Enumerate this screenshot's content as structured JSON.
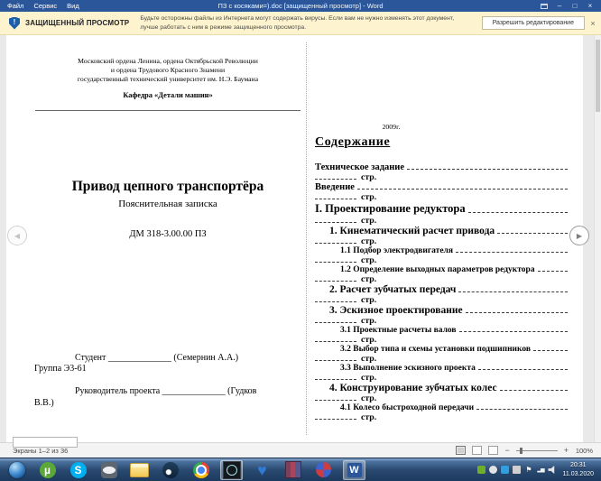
{
  "window": {
    "menu": [
      "Файл",
      "Сервис",
      "Вид"
    ],
    "title": "ПЗ с косяками=).doc [защищенный просмотр] - Word"
  },
  "banner": {
    "label": "ЗАЩИЩЕННЫЙ ПРОСМОТР",
    "message": "Будьте осторожны файлы из Интернета могут содержать вирусы. Если вам не нужно изменять этот документ, лучше работать с ним в режиме защищенного просмотра.",
    "button_label": "Разрешить редактирование"
  },
  "document": {
    "left_page": {
      "university_line1": "Московский ордена Ленина, ордена Октябрьской Революции",
      "university_line2": "и ордена Трудового Красного Знамени",
      "university_line3": "государственный технический университет им. Н.Э. Баумана",
      "department": "Кафедра «Детали машин»",
      "title": "Привод цепного транспортёра",
      "subtitle": "Пояснительная записка",
      "doc_code": "ДМ 318-3.00.00 ПЗ",
      "student_line": "Студент ______________ (Семернин А.А.)",
      "group_line": "Группа Э3-61",
      "supervisor_line1": "Руководитель проекта ______________ (Гудков",
      "supervisor_line2": "В.В.)"
    },
    "right_page": {
      "year": "2009г.",
      "heading": "Содержание",
      "page_word": "стр.",
      "entries": [
        {
          "label": "Техническое задание",
          "level": 0,
          "cls": "t-main"
        },
        {
          "label": "Введение",
          "level": 0,
          "cls": "t-main"
        },
        {
          "label": "I. Проектирование редуктора",
          "level": 0,
          "cls": "t-chapter"
        },
        {
          "label": "1. Кинематический расчет привода",
          "level": 1,
          "cls": "t-section"
        },
        {
          "label": "1.1 Подбор электродвигателя",
          "level": 2,
          "cls": "t-sub"
        },
        {
          "label": "1.2 Определение выходных параметров редуктора",
          "level": 2,
          "cls": "t-sub"
        },
        {
          "label": "2. Расчет зубчатых передач",
          "level": 1,
          "cls": "t-section"
        },
        {
          "label": "3. Эскизное проектирование",
          "level": 1,
          "cls": "t-section"
        },
        {
          "label": "3.1 Проектные расчеты валов",
          "level": 2,
          "cls": "t-sub"
        },
        {
          "label": "3.2 Выбор типа и схемы установки подшипников",
          "level": 2,
          "cls": "t-sub"
        },
        {
          "label": "3.3 Выполнение эскизного проекта",
          "level": 2,
          "cls": "t-sub"
        },
        {
          "label": "4. Конструирование зубчатых колес",
          "level": 1,
          "cls": "t-section"
        },
        {
          "label": "4.1 Колесо быстроходной передачи",
          "level": 2,
          "cls": "t-sub"
        }
      ]
    }
  },
  "status_bar": {
    "screens": "Экраны 1–2 из 36",
    "zoom_level": "100%"
  },
  "taskbar": {
    "icons": [
      "start-button",
      "utorrent-icon",
      "skype-icon",
      "discord-icon",
      "explorer-icon",
      "steam-icon",
      "chrome-icon",
      "osu-icon",
      "heart-icon",
      "winrar-icon",
      "media-app-icon",
      "word-icon"
    ],
    "active_icons": [
      "osu-icon",
      "word-icon"
    ],
    "tray_icons": [
      "gpu-tray-icon",
      "update-tray-icon",
      "app-tray-icon",
      "usb-tray-icon",
      "flag-tray-icon",
      "network-tray-icon",
      "volume-tray-icon"
    ],
    "clock_time": "20:31",
    "clock_date": "11.03.2020"
  },
  "colors": {
    "titlebar_blue": "#2b579a",
    "banner_yellow": "#fdf3cf",
    "taskbar_blue": "#2a4970",
    "word_brand_blue": "#2b579a"
  }
}
